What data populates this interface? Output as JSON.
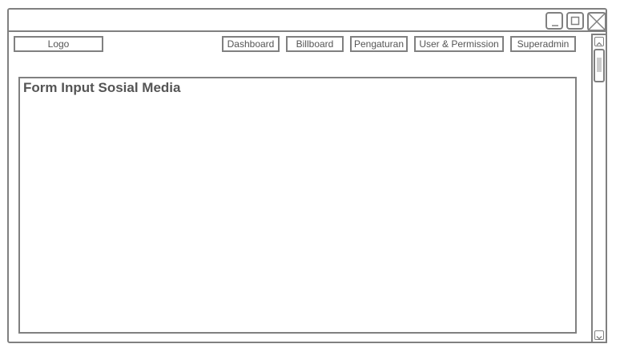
{
  "window": {
    "controls": [
      "minimize-icon",
      "maximize-icon",
      "close-icon"
    ]
  },
  "header": {
    "logo": "Logo",
    "nav": [
      "Dashboard",
      "Billboard",
      "Pengaturan",
      "User & Permission",
      "Superadmin"
    ]
  },
  "main": {
    "title": "Form Input Sosial Media"
  },
  "colors": {
    "border": "#808080",
    "background": "#ffffff",
    "text": "#555555"
  }
}
